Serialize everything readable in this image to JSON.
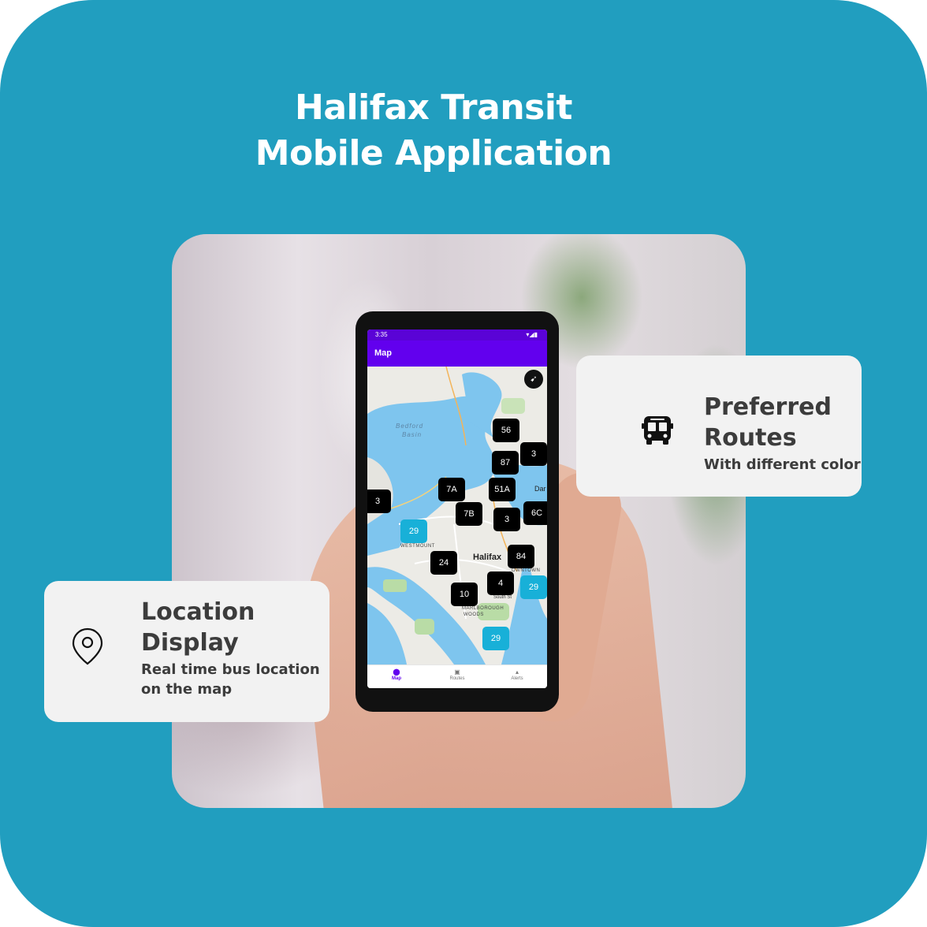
{
  "page": {
    "title_line1": "Halifax Transit",
    "title_line2": "Mobile Application"
  },
  "colors": {
    "background": "#219ebf",
    "card": "#f2f2f2",
    "app_primary": "#6200ee",
    "marker_default": "#000000",
    "marker_preferred": "#18b0d8"
  },
  "phone": {
    "status_bar": {
      "time": "3:35"
    },
    "app_bar": {
      "title": "Map"
    },
    "map": {
      "compass_icon": "compass-icon",
      "place_labels": {
        "city": "Halifax",
        "dartmouth_partial": "Dar",
        "basin_line1": "Bedford",
        "basin_line2": "Basin",
        "westmount": "WESTMOUNT",
        "downtown_partial": "OWNTOWN",
        "marlborough": "MARLBOROUGH",
        "woods": "WOODS",
        "south_st": "South St"
      },
      "markers": [
        {
          "route": "56",
          "preferred": false
        },
        {
          "route": "3",
          "preferred": false
        },
        {
          "route": "87",
          "preferred": false
        },
        {
          "route": "7A",
          "preferred": false
        },
        {
          "route": "51A",
          "preferred": false
        },
        {
          "route": "3",
          "preferred": false
        },
        {
          "route": "7B",
          "preferred": false
        },
        {
          "route": "3",
          "preferred": false
        },
        {
          "route": "6C",
          "preferred": false
        },
        {
          "route": "29",
          "preferred": true
        },
        {
          "route": "84",
          "preferred": false
        },
        {
          "route": "24",
          "preferred": false
        },
        {
          "route": "4",
          "preferred": false
        },
        {
          "route": "29",
          "preferred": true
        },
        {
          "route": "10",
          "preferred": false
        },
        {
          "route": "29",
          "preferred": true
        }
      ]
    },
    "bottom_nav": [
      {
        "label": "Map",
        "icon": "map-pin-icon",
        "active": true
      },
      {
        "label": "Routes",
        "icon": "bus-icon",
        "active": false
      },
      {
        "label": "Alerts",
        "icon": "bell-icon",
        "active": false
      }
    ]
  },
  "cards": {
    "routes": {
      "icon": "bus-icon",
      "title_line1": "Preferred",
      "title_line2": "Routes",
      "subtitle": "With different color"
    },
    "location": {
      "icon": "map-pin-icon",
      "title_line1": "Location",
      "title_line2": "Display",
      "subtitle_line1": "Real time bus location",
      "subtitle_line2": "on the map"
    }
  }
}
